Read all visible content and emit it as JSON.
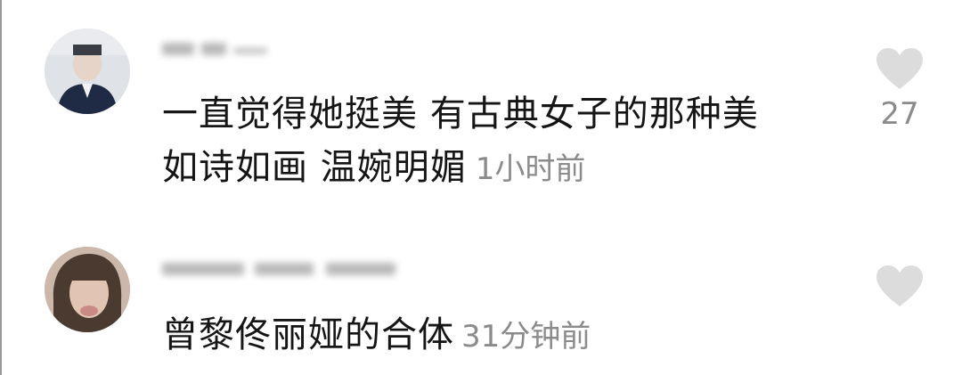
{
  "comments": [
    {
      "username": "",
      "text_line1": "一直觉得她挺美 有古典女子的那种美",
      "text_line2": "如诗如画 温婉明媚",
      "time": "1小时前",
      "likes": "27",
      "liked": false,
      "avatar_icon": "user-avatar-icon"
    },
    {
      "username": "",
      "text": "曾黎佟丽娅的合体",
      "time": "31分钟前",
      "likes": "",
      "liked": false,
      "avatar_icon": "user-avatar-icon"
    }
  ],
  "colors": {
    "text": "#151515",
    "muted": "#8b8b8b",
    "heart": "#dcdcdc"
  }
}
